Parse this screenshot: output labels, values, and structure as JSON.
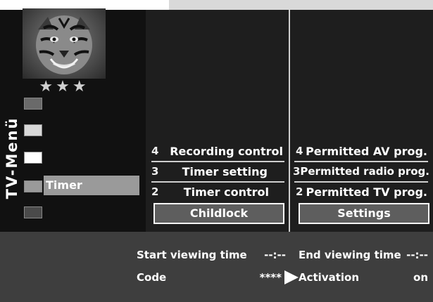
{
  "menu_title": "TV-Menü",
  "rating_stars": "★★★",
  "icons": {
    "thumbnail": "tiger-image",
    "pointer": "right-triangle-icon"
  },
  "left_menu": {
    "items": [
      {
        "label": "",
        "color": "#6a6a6a"
      },
      {
        "label": "",
        "color": "#d8d8d8"
      },
      {
        "label": "",
        "color": "#ffffff"
      },
      {
        "label": "Timer",
        "color": "#9a9a9a",
        "selected": true
      },
      {
        "label": "",
        "color": "#4a4a4a"
      }
    ]
  },
  "middle_menu": {
    "items": [
      {
        "number": "4",
        "label": "Recording control"
      },
      {
        "number": "3",
        "label": "Timer setting"
      },
      {
        "number": "2",
        "label": "Timer control"
      }
    ],
    "selected": "Childlock"
  },
  "right_menu": {
    "items": [
      {
        "number": "4",
        "label": "Permitted AV prog."
      },
      {
        "number": "3",
        "label": "Permitted radio prog."
      },
      {
        "number": "2",
        "label": "Permitted TV prog."
      }
    ],
    "selected": "Settings"
  },
  "settings": {
    "start_viewing_time": {
      "label": "Start viewing time",
      "value": "--:--"
    },
    "end_viewing_time": {
      "label": "End viewing time",
      "value": "--:--"
    },
    "code": {
      "label": "Code",
      "value": "****"
    },
    "activation": {
      "label": "Activation",
      "value": "on"
    }
  }
}
